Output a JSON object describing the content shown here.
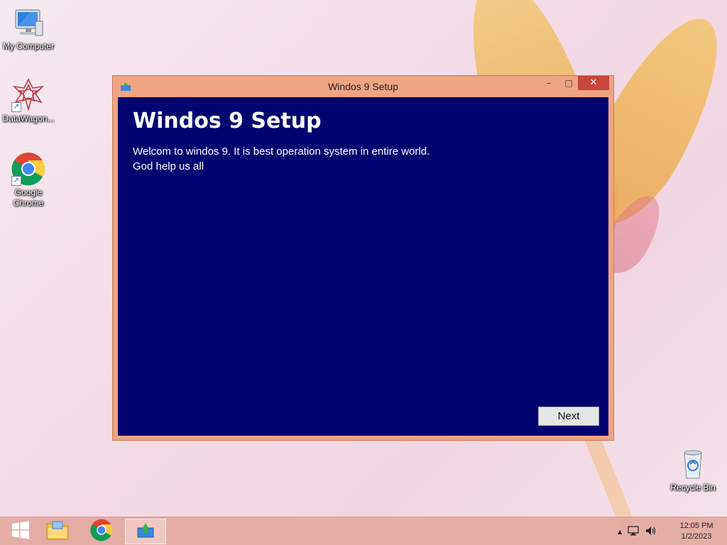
{
  "desktop": {
    "icons": [
      {
        "label": "My Computer",
        "icon": "computer-icon"
      },
      {
        "label": "DataWagon...",
        "icon": "datawagon-icon"
      },
      {
        "label": "Google Chrome",
        "icon": "chrome-icon"
      },
      {
        "label": "Recycle Bin",
        "icon": "recycle-bin-icon"
      }
    ]
  },
  "window": {
    "title": "Windos 9 Setup",
    "heading": "Windos 9 Setup",
    "welcome_line1": "Welcom to windos 9. It is best operation system in entire world.",
    "welcome_line2": "God help us all",
    "next_label": "Next",
    "minimize_glyph": "–",
    "maximize_glyph": "□",
    "close_glyph": "✕",
    "client_bg": "#020270",
    "frame_color": "#f0a482"
  },
  "taskbar": {
    "items": [
      "start-icon",
      "file-explorer-icon",
      "chrome-icon",
      "setup-app-icon"
    ],
    "tray": {
      "time": "12:05 PM",
      "date": "1/2/2023",
      "chevron": "▲"
    }
  }
}
